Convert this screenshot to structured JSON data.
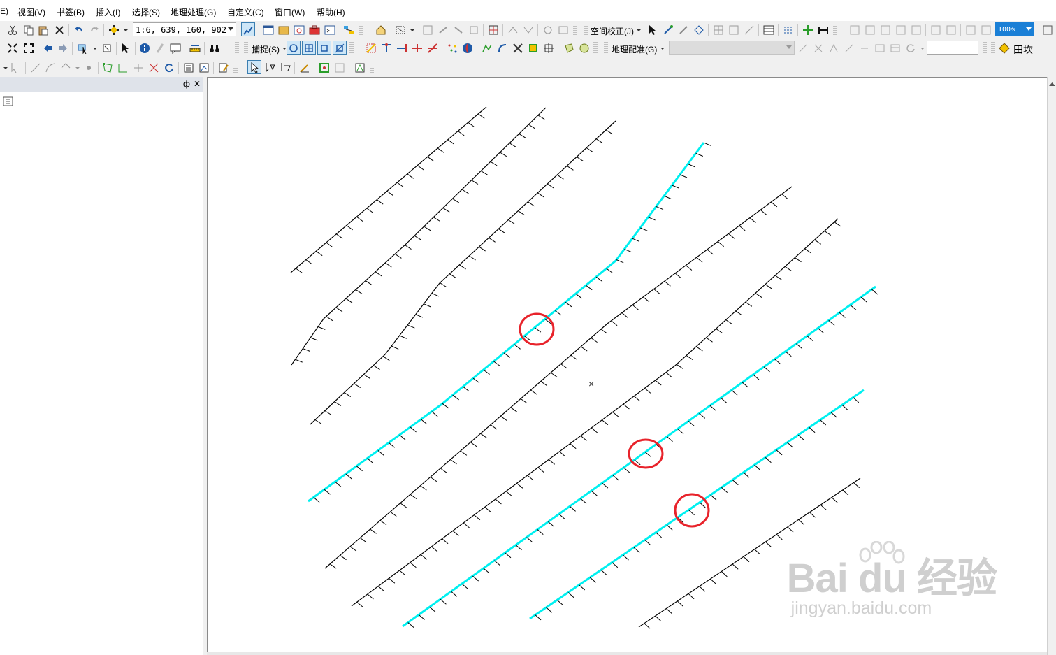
{
  "menu": {
    "items": [
      "E)",
      "视图(V)",
      "书签(B)",
      "插入(I)",
      "选择(S)",
      "地理处理(G)",
      "自定义(C)",
      "窗口(W)",
      "帮助(H)"
    ]
  },
  "toolbar1": {
    "scale_value": "1:6, 639, 160, 902",
    "spatial_adjust_label": "空间校正(J)",
    "zoom_percent": "100%"
  },
  "toolbar2": {
    "snapping_label": "捕捉(S)",
    "georef_label": "地理配准(G)",
    "georef_layer": "",
    "rotation_value": "",
    "layer_name": "田坎"
  },
  "panel": {
    "pin": "ф",
    "close": "✕"
  },
  "map": {
    "center_mark": "×",
    "accent_color": "#00f0f0",
    "line_color": "#000000",
    "highlight_circle_color": "#e8232b"
  },
  "watermark": {
    "brand": "Bai du 经验",
    "url": "jingyan.baidu.com"
  }
}
